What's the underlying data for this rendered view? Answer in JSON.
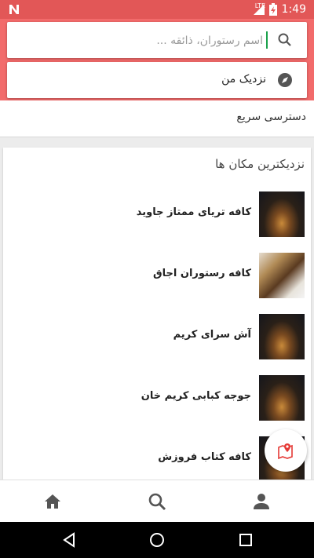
{
  "status_bar": {
    "time": "1:49",
    "network_label": "LTE",
    "icons": [
      "n-notification-icon",
      "lte-signal-icon",
      "battery-charging-icon"
    ]
  },
  "search": {
    "placeholder": "اسم رستوران، ذائقه ...",
    "value": ""
  },
  "near_me": {
    "label": "نزدیک من"
  },
  "quick_access": {
    "label": "دسترسی سریع"
  },
  "nearby": {
    "title": "نزدیکترین مکان ها",
    "items": [
      {
        "name": "کافه تریای ممتاز جاوید",
        "thumb": "dark"
      },
      {
        "name": "کافه رستوران اجاق",
        "thumb": "interior"
      },
      {
        "name": "آش سرای کریم",
        "thumb": "dark"
      },
      {
        "name": "جوجه کبابی کریم خان",
        "thumb": "dark"
      },
      {
        "name": "کافه کتاب فروزش",
        "thumb": "dark"
      }
    ]
  },
  "bottom_nav": {
    "items": [
      "home-icon",
      "search-icon",
      "profile-icon"
    ]
  },
  "colors": {
    "status_bar": "#e25757",
    "header": "#f26b6b",
    "accent": "#1aa14b",
    "map_pin": "#e53935"
  }
}
